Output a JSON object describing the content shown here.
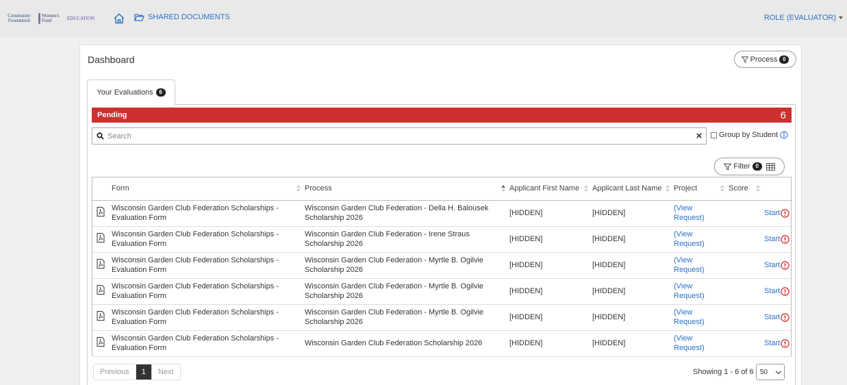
{
  "topbar": {
    "logos": [
      {
        "name": "community-foundation-logo",
        "text": "Community Foundation"
      },
      {
        "name": "womens-fund-logo",
        "text": "Women's Fund"
      },
      {
        "name": "education-logo",
        "text": "EDUCATION"
      }
    ],
    "shared_documents_label": "SHARED DOCUMENTS",
    "role_label": "ROLE (EVALUATOR)"
  },
  "dashboard": {
    "title": "Dashboard",
    "process_button_label": "Process",
    "process_count": "0"
  },
  "tabs": [
    {
      "label": "Your Evaluations",
      "count": "6"
    }
  ],
  "pending": {
    "label": "Pending",
    "count": "6"
  },
  "search": {
    "placeholder": "Search",
    "value": ""
  },
  "group_by_label": "Group by Student",
  "filter": {
    "label": "Filter",
    "count": "0"
  },
  "table": {
    "columns": [
      "",
      "Form",
      "Process",
      "Applicant First Name",
      "Applicant Last Name",
      "Project",
      "Score",
      ""
    ],
    "rows": [
      {
        "form": "Wisconsin Garden Club Federation Scholarships - Evaluation Form",
        "process": "Wisconsin Garden Club Federation - Della H. Balousek Scholarship 2026",
        "first_name": "[HIDDEN]",
        "last_name": "[HIDDEN]",
        "project": "(View Request)",
        "score": "",
        "action": "Start"
      },
      {
        "form": "Wisconsin Garden Club Federation Scholarships - Evaluation Form",
        "process": "Wisconsin Garden Club Federation - Irene Straus Scholarship 2026",
        "first_name": "[HIDDEN]",
        "last_name": "[HIDDEN]",
        "project": "(View Request)",
        "score": "",
        "action": "Start"
      },
      {
        "form": "Wisconsin Garden Club Federation Scholarships - Evaluation Form",
        "process": "Wisconsin Garden Club Federation - Myrtle B. Ogilvie Scholarship 2026",
        "first_name": "[HIDDEN]",
        "last_name": "[HIDDEN]",
        "project": "(View Request)",
        "score": "",
        "action": "Start"
      },
      {
        "form": "Wisconsin Garden Club Federation Scholarships - Evaluation Form",
        "process": "Wisconsin Garden Club Federation - Myrtle B. Ogilvie Scholarship 2026",
        "first_name": "[HIDDEN]",
        "last_name": "[HIDDEN]",
        "project": "(View Request)",
        "score": "",
        "action": "Start"
      },
      {
        "form": "Wisconsin Garden Club Federation Scholarships - Evaluation Form",
        "process": "Wisconsin Garden Club Federation - Myrtle B. Ogilvie Scholarship 2026",
        "first_name": "[HIDDEN]",
        "last_name": "[HIDDEN]",
        "project": "(View Request)",
        "score": "",
        "action": "Start"
      },
      {
        "form": "Wisconsin Garden Club Federation Scholarships - Evaluation Form",
        "process": "Wisconsin Garden Club Federation Scholarship 2026",
        "first_name": "[HIDDEN]",
        "last_name": "[HIDDEN]",
        "project": "(View Request)",
        "score": "",
        "action": "Start"
      }
    ]
  },
  "pagination": {
    "previous": "Previous",
    "current": "1",
    "next": "Next",
    "showing": "Showing 1 - 6 of 6",
    "page_size": "50"
  },
  "colors": {
    "pending_bar": "#cd3030",
    "link": "#2870c8",
    "warning": "#d42020"
  }
}
